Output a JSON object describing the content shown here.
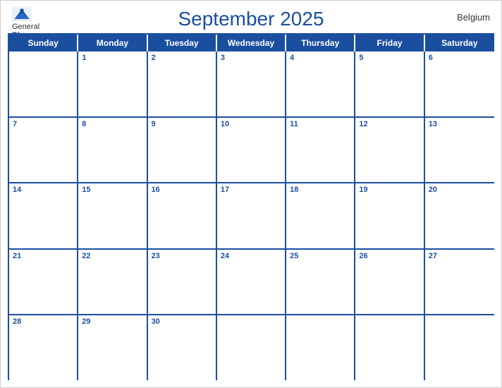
{
  "header": {
    "title": "September 2025",
    "country": "Belgium",
    "logo": {
      "general": "General",
      "blue": "Blue"
    }
  },
  "days_of_week": [
    "Sunday",
    "Monday",
    "Tuesday",
    "Wednesday",
    "Thursday",
    "Friday",
    "Saturday"
  ],
  "weeks": [
    [
      {
        "date": "",
        "inMonth": false
      },
      {
        "date": "1",
        "inMonth": true
      },
      {
        "date": "2",
        "inMonth": true
      },
      {
        "date": "3",
        "inMonth": true
      },
      {
        "date": "4",
        "inMonth": true
      },
      {
        "date": "5",
        "inMonth": true
      },
      {
        "date": "6",
        "inMonth": true
      }
    ],
    [
      {
        "date": "7",
        "inMonth": true
      },
      {
        "date": "8",
        "inMonth": true
      },
      {
        "date": "9",
        "inMonth": true
      },
      {
        "date": "10",
        "inMonth": true
      },
      {
        "date": "11",
        "inMonth": true
      },
      {
        "date": "12",
        "inMonth": true
      },
      {
        "date": "13",
        "inMonth": true
      }
    ],
    [
      {
        "date": "14",
        "inMonth": true
      },
      {
        "date": "15",
        "inMonth": true
      },
      {
        "date": "16",
        "inMonth": true
      },
      {
        "date": "17",
        "inMonth": true
      },
      {
        "date": "18",
        "inMonth": true
      },
      {
        "date": "19",
        "inMonth": true
      },
      {
        "date": "20",
        "inMonth": true
      }
    ],
    [
      {
        "date": "21",
        "inMonth": true
      },
      {
        "date": "22",
        "inMonth": true
      },
      {
        "date": "23",
        "inMonth": true
      },
      {
        "date": "24",
        "inMonth": true
      },
      {
        "date": "25",
        "inMonth": true
      },
      {
        "date": "26",
        "inMonth": true
      },
      {
        "date": "27",
        "inMonth": true
      }
    ],
    [
      {
        "date": "28",
        "inMonth": true
      },
      {
        "date": "29",
        "inMonth": true
      },
      {
        "date": "30",
        "inMonth": true
      },
      {
        "date": "",
        "inMonth": false
      },
      {
        "date": "",
        "inMonth": false
      },
      {
        "date": "",
        "inMonth": false
      },
      {
        "date": "",
        "inMonth": false
      }
    ]
  ],
  "colors": {
    "header_bg": "#1a4fa0",
    "header_text": "#ffffff",
    "date_color": "#1a4fa0",
    "border_color": "#1a4fa0"
  }
}
